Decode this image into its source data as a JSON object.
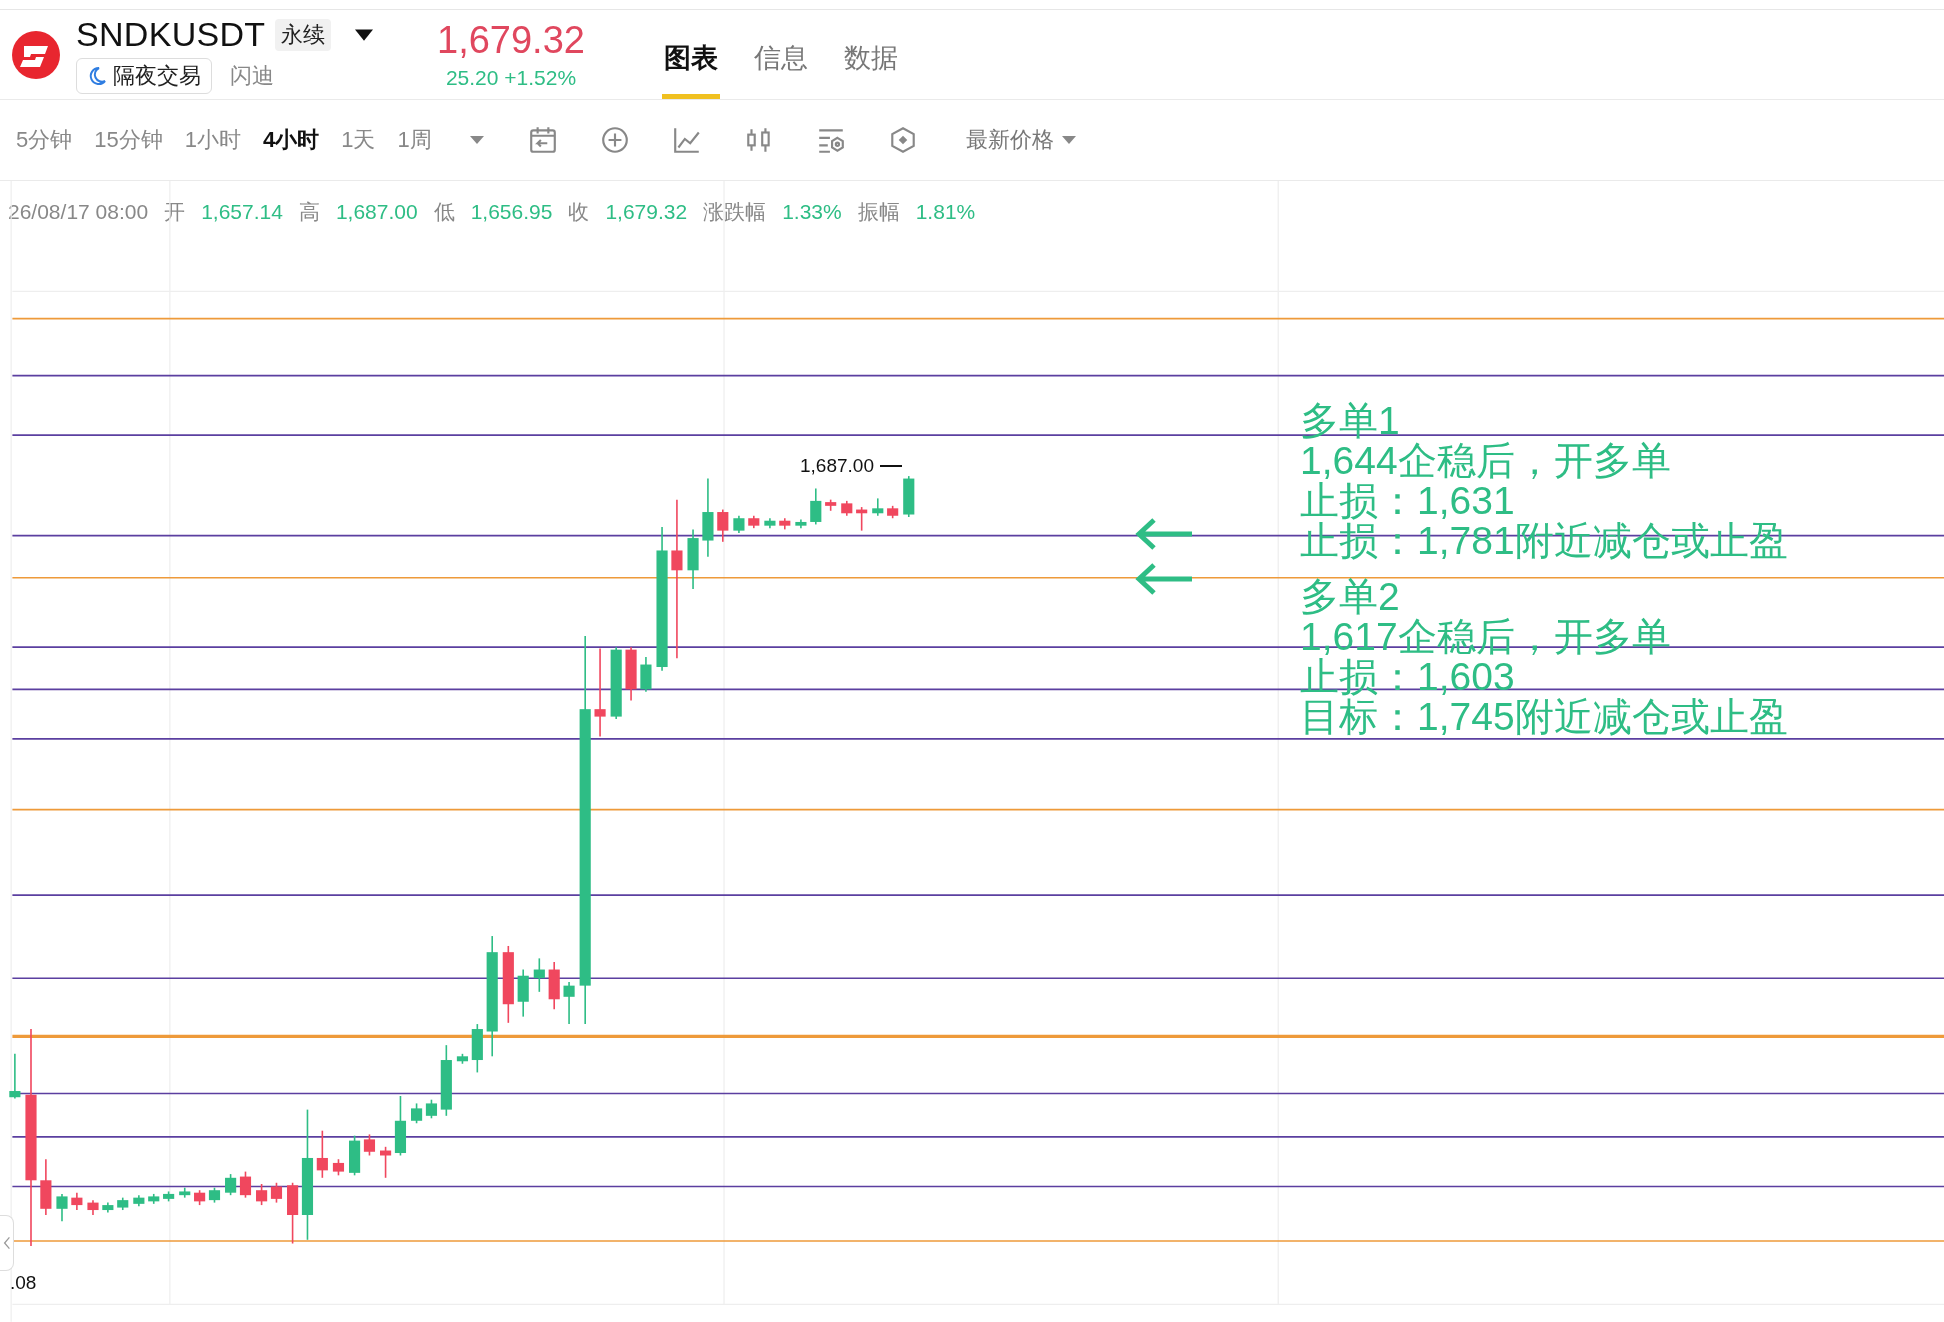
{
  "header": {
    "symbol": "SNDKUSDT",
    "contract_type": "永续",
    "overnight_badge": "隔夜交易",
    "name": "闪迪",
    "price": "1,679.32",
    "change": "25.20 +1.52%"
  },
  "tabs": [
    {
      "label": "图表",
      "selected": true
    },
    {
      "label": "信息",
      "selected": false
    },
    {
      "label": "数据",
      "selected": false
    }
  ],
  "intervals": [
    {
      "label": "5分钟",
      "selected": false
    },
    {
      "label": "15分钟",
      "selected": false
    },
    {
      "label": "1小时",
      "selected": false
    },
    {
      "label": "4小时",
      "selected": true
    },
    {
      "label": "1天",
      "selected": false
    },
    {
      "label": "1周",
      "selected": false
    }
  ],
  "price_type": "最新价格",
  "ohlc": {
    "time": "26/08/17 08:00",
    "fields": [
      {
        "label": "开",
        "value": "1,657.14"
      },
      {
        "label": "高",
        "value": "1,687.00"
      },
      {
        "label": "低",
        "value": "1,656.95"
      },
      {
        "label": "收",
        "value": "1,679.32"
      },
      {
        "label": "涨跌幅",
        "value": "1.33%"
      },
      {
        "label": "振幅",
        "value": "1.81%"
      }
    ]
  },
  "chart": {
    "high_label": "1,687.00",
    "x_label": ".08",
    "notes": [
      {
        "title": "多单1",
        "lines": [
          "1,644企稳后，开多单",
          "止损：1,631",
          "止损：1,781附近减仓或止盈"
        ]
      },
      {
        "title": "多单2",
        "lines": [
          "1,617企稳后，开多单",
          "止损：1,603",
          "目标：1,745附近减仓或止盈"
        ]
      }
    ]
  }
}
